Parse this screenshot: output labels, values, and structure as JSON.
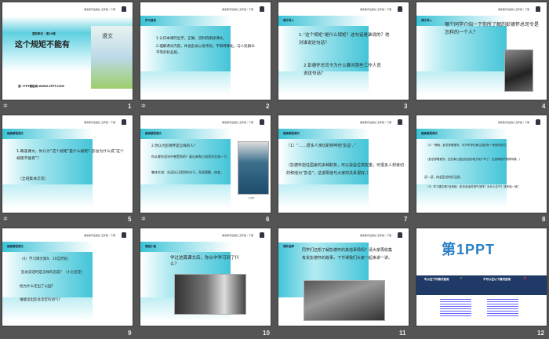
{
  "header": "湖北教育出版社 五年级｜下册",
  "slides": [
    {
      "num": "1",
      "subtitle": "第四单元 · 第10课",
      "title": "这个规矩不能有",
      "footer": "第一PPT模板网-WWW.1PPT.COM",
      "book": "语文"
    },
    {
      "num": "2",
      "label": "学习目标",
      "lines": [
        "1.认识本课的生字，正确、流利的朗读课文。",
        "2.理解课文内容，体会彭总以身作则，不搞特殊化，与人民群众平等的好品质。"
      ]
    },
    {
      "num": "3",
      "label": "课文导入",
      "lines": [
        "1.“这个规矩”是什么规矩？这句话是谁说的？他对谁说这句话？",
        "2.彭德怀总司令为什么要对那些工作人员说这句话？"
      ]
    },
    {
      "num": "4",
      "label": "课文导入",
      "lines": [
        "哪个同学介绍一下你所了解的彭德怀总司令是怎样的一个人？"
      ]
    },
    {
      "num": "5",
      "label": "细读感悟课文",
      "lines": [
        "1.再读课文，你认为“这个规矩”是什么规矩？彭总为什么说“这个规矩不能有”？",
        "（全班集体交流）"
      ]
    },
    {
      "num": "6",
      "label": "细读感悟课文",
      "lines": [
        "2.你认为彭德怀是怎样的人？",
        "你从哪些语句中感受到的？画出来和小组同学交流一下。",
        "集体交流：先读自己找到的句子，再说理解、体会。"
      ],
      "caption": "彭德怀"
    },
    {
      "num": "7",
      "label": "细读感悟课文",
      "lines": [
        "（1）“……很多人亲切的称呼他‘彭总’。”",
        "（彭德怀担任国家的多种职务，可以说是位高权重，可很多人却亲切的称他为“彭总”，这说明他与大家的关系很好。）"
      ]
    },
    {
      "num": "8",
      "label": "细读感悟课文",
      "lines": [
        "（2）“傍晚，彭总穿着便衣，叫汽车停在离公园还有一条街的地方。",
        "（彭总穿着便衣，还在离公园比较远的地方就下车了，这说明他不想搞特殊。）",
        "读一读，体会彭总的好品质。",
        "（3）学习课文第7自然段：彭总说话时语气怎样？为什么生气？请来读一读？"
      ]
    },
    {
      "num": "9",
      "label": "细读感悟课文",
      "lines": [
        "（4）学习课文第9、10自然段：",
        "彭总说话时是怎样的态度？（十分坚定）",
        "他为什么走出了公园？",
        "谁能读出彭总坚定的语气？"
      ]
    },
    {
      "num": "10",
      "label": "课堂小结",
      "lines": [
        "学过这篇课文后，你从中学习到了什么？"
      ]
    },
    {
      "num": "11",
      "label": "课外延伸",
      "lines": [
        "同学们还想了解彭德怀的其他事情吗？请大家再收集有关彭德怀的故事，下节课我们大家一起来讲一讲。"
      ]
    },
    {
      "num": "12",
      "brand": "第1PPT",
      "can": "可以在下列情况使用",
      "cannot": "不可以在以下情况使用"
    }
  ],
  "colors": {
    "accent": "#3cc3d6",
    "bg": "#545454",
    "navy": "#1f3a66"
  }
}
